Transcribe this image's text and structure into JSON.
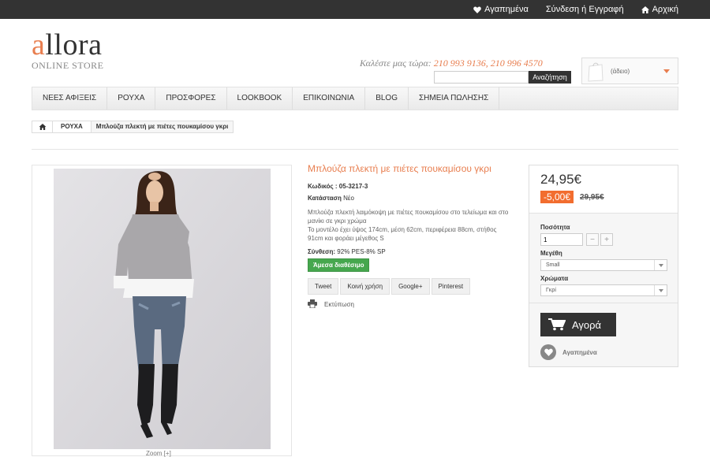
{
  "topbar": {
    "favorites": "Αγαπημένα",
    "login": "Σύνδεση ή Εγγραφή",
    "home": "Αρχική"
  },
  "logo": {
    "first_letter": "a",
    "rest": "llora",
    "subtitle": "ONLINE STORE"
  },
  "contact": {
    "label": "Καλέστε μας τώρα:",
    "phones": "210 993 9136, 210 996 4570"
  },
  "search": {
    "placeholder": "",
    "button": "Αναζήτηση"
  },
  "cart": {
    "label": "(άδειο)",
    "icon": "shopping-bag-icon"
  },
  "nav": {
    "items": [
      "ΝΕΕΣ ΑΦΙΞΕΙΣ",
      "ΡΟΥΧΑ",
      "ΠΡΟΣΦΟΡΕΣ",
      "LOOKBOOK",
      "ΕΠΙΚΟΙΝΩΝΙΑ",
      "BLOG",
      "ΣΗΜΕΙΑ ΠΩΛΗΣΗΣ"
    ]
  },
  "breadcrumb": {
    "category": "ΡΟΥΧΑ",
    "product": "Μπλούζα πλεκτή με πιέτες πουκαμίσου γκρι"
  },
  "product": {
    "title": "Μπλούζα πλεκτή με πιέτες πουκαμίσου γκρι",
    "code_label": "Κωδικός :",
    "code": "05-3217-3",
    "condition_label": "Κατάσταση",
    "condition": "Νέο",
    "desc1": "Μπλούζα πλεκτή λαιμόκοψη με πιέτες πουκαμίσου στο τελείωμα και στο μανίκι σε γκρι χρώμα",
    "desc2": "Το μοντέλο έχει ύψος 174cm, μέση 62cm, περιφέρεια 88cm, στήθος 91cm και φοράει μέγεθος S",
    "composition_label": "Σύνθεση:",
    "composition": "92% PES-8% SP",
    "availability": "Άμεσα διαθέσιμο",
    "share": [
      "Tweet",
      "Κοινή χρήση",
      "Google+",
      "Pinterest"
    ],
    "print": "Εκτύπωση",
    "zoom": "Zoom [+]"
  },
  "buy": {
    "price": "24,95€",
    "discount": "-5,00€",
    "old_price": "29,95€",
    "qty_label": "Ποσότητα",
    "qty_value": "1",
    "minus": "−",
    "plus": "+",
    "size_label": "Μεγέθη",
    "size_value": "Small",
    "color_label": "Χρώματα",
    "color_value": "Γκρί",
    "buy_button": "Αγορά",
    "wishlist": "Αγαπημένα"
  },
  "colors": {
    "accent": "#e87e4f",
    "discount": "#f26d2f",
    "available": "#46a74e",
    "dark": "#333333"
  }
}
